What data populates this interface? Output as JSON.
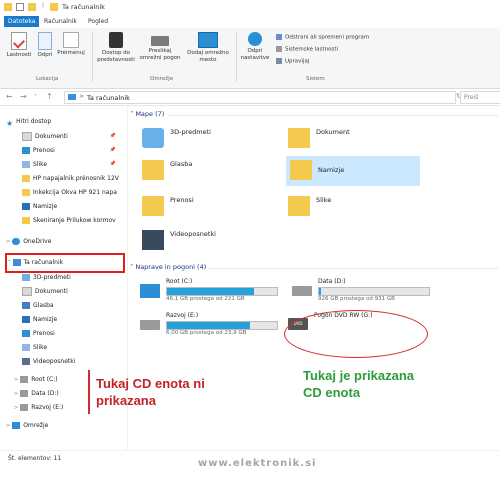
{
  "window": {
    "title": "Ta računalnik"
  },
  "tabs": [
    {
      "label": "Datoteka"
    },
    {
      "label": "Računalnik"
    },
    {
      "label": "Pogled"
    }
  ],
  "ribbon": {
    "location": {
      "group_label": "Lokacija",
      "properties": "Lastnosti",
      "open": "Odpri",
      "rename": "Preimenuj"
    },
    "network": {
      "group_label": "Omrežje",
      "media": "Dostop do predstavnosti",
      "map_drive": "Preslikaj omrežni pogon",
      "add_location": "Dodaj omrežno mesto"
    },
    "system": {
      "group_label": "Sistem",
      "open_settings": "Odpri nastavitve",
      "uninstall": "Odstrani ali spremeni program",
      "system_properties": "Sistemske lastnosti",
      "manage": "Upravljaj"
    }
  },
  "address": {
    "path": "Ta računalnik",
    "search_placeholder": "Preiš"
  },
  "nav": {
    "quick_access": "Hitri dostop",
    "items": [
      {
        "label": "Dokumenti",
        "pinned": true
      },
      {
        "label": "Prenosi",
        "pinned": true
      },
      {
        "label": "Slike",
        "pinned": true
      },
      {
        "label": "HP napajalnik prénosnik 12V",
        "pinned": false
      },
      {
        "label": "Inkekcija Okva HP 921 napa",
        "pinned": false
      },
      {
        "label": "Namizje",
        "pinned": false
      },
      {
        "label": "Skeniranje Prilukow kormov",
        "pinned": false
      }
    ],
    "onedrive": "OneDrive",
    "this_pc": "Ta računalnik",
    "pc_items": [
      {
        "label": "3D-predmeti"
      },
      {
        "label": "Dokumenti"
      },
      {
        "label": "Glasba"
      },
      {
        "label": "Namizje"
      },
      {
        "label": "Prenosi"
      },
      {
        "label": "Slike"
      },
      {
        "label": "Videoposnetki"
      },
      {
        "label": "Root (C:)"
      },
      {
        "label": "Data (D:)"
      },
      {
        "label": "Razvoj (E:)"
      }
    ],
    "network": "Omrežje"
  },
  "content": {
    "folders_header": "Mape (7)",
    "folders": [
      {
        "label": "3D-predmeti"
      },
      {
        "label": "Dokument"
      },
      {
        "label": "Glasba"
      },
      {
        "label": "Namizje"
      },
      {
        "label": "Prenosi"
      },
      {
        "label": "Slike"
      },
      {
        "label": "Videoposnetki"
      }
    ],
    "drives_header": "Naprave in pogoni (4)",
    "drives": [
      {
        "name": "Root (C:)",
        "free": "46,1 GB prostega od 221 GB",
        "used_fraction": 0.79
      },
      {
        "name": "Data (D:)",
        "free": "926 GB prostega od 931 GB",
        "used_fraction": 0.02
      },
      {
        "name": "Razvoj (E:)",
        "free": "6,00 GB prostega od 23,9 GB",
        "used_fraction": 0.75
      },
      {
        "name": "Pogon DVD RW (G:)",
        "free": "",
        "used_fraction": null
      }
    ]
  },
  "status": {
    "text": "Št. elementov: 11"
  },
  "watermark": "www.elektronik.si",
  "annotations": {
    "red_line1": "Tukaj CD enota ni",
    "red_line2": "prikazana",
    "green_line1": "Tukaj je prikazana",
    "green_line2": "CD enota"
  },
  "colors": {
    "accent": "#1979ca",
    "drive_bar": "#26a0da",
    "folder": "#f3c94e",
    "annotation_red": "#c22222",
    "annotation_green": "#2e9b3c"
  }
}
